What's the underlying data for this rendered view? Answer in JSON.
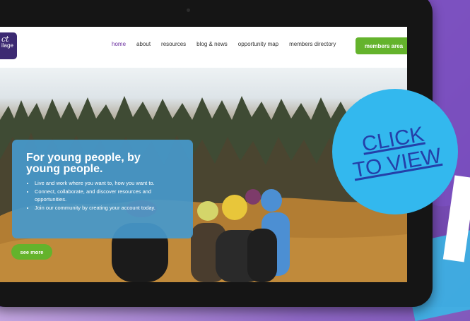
{
  "nav": {
    "logo_text_1": "ct",
    "logo_text_2": "ilage",
    "links": [
      "home",
      "about",
      "resources",
      "blog & news",
      "opportunity map",
      "members directory"
    ],
    "members_button": "members area"
  },
  "hero": {
    "title_line1": "For young people, by",
    "title_line2": "young people.",
    "bullets": [
      "Live and work where you want to, how you want to.",
      "Connect, collaborate, and discover resources and opportunities.",
      "Join our community by creating your account today."
    ],
    "see_more": "see more",
    "slides": 4,
    "active_slide": 2
  },
  "overlay": {
    "line1": "CLICK",
    "line2": "TO VIEW",
    "circle_color": "#33b8ee",
    "text_color": "#2440a9"
  },
  "colors": {
    "accent_green": "#64b32c",
    "card_blue": "#4799cc",
    "nav_active": "#6b2fa0"
  }
}
